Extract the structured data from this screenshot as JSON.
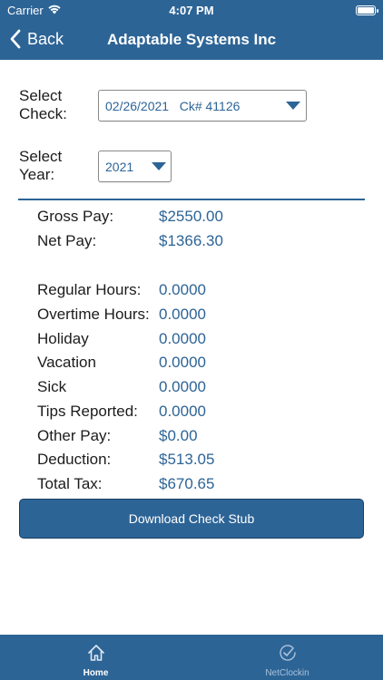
{
  "status_bar": {
    "carrier": "Carrier",
    "time": "4:07 PM"
  },
  "nav": {
    "back_label": "Back",
    "title": "Adaptable Systems Inc"
  },
  "select_check": {
    "label_line1": "Select",
    "label_line2": "Check:",
    "value": "02/26/2021   Ck# 41126"
  },
  "select_year": {
    "label_line1": "Select",
    "label_line2": "Year:",
    "value": "2021"
  },
  "pay_summary": [
    {
      "label": "Gross Pay:",
      "value": "$2550.00"
    },
    {
      "label": "Net Pay:",
      "value": "$1366.30"
    }
  ],
  "details": [
    {
      "label": "Regular Hours:",
      "value": "0.0000"
    },
    {
      "label": "Overtime Hours:",
      "value": "0.0000"
    },
    {
      "label": "Holiday",
      "value": "0.0000"
    },
    {
      "label": "Vacation",
      "value": "0.0000"
    },
    {
      "label": "Sick",
      "value": "0.0000"
    },
    {
      "label": "Tips Reported:",
      "value": "0.0000"
    },
    {
      "label": "Other Pay:",
      "value": "$0.00"
    },
    {
      "label": "Deduction:",
      "value": "$513.05"
    },
    {
      "label": "Total Tax:",
      "value": "$670.65"
    }
  ],
  "download_button_label": "Download Check Stub",
  "tabs": [
    {
      "label": "Home",
      "icon": "home-icon",
      "active": true
    },
    {
      "label": "NetClockin",
      "icon": "checkmark-clock-icon",
      "active": false
    }
  ],
  "colors": {
    "primary": "#2d6496",
    "value_text": "#2d6496",
    "inactive_tab": "#aac3dc"
  }
}
